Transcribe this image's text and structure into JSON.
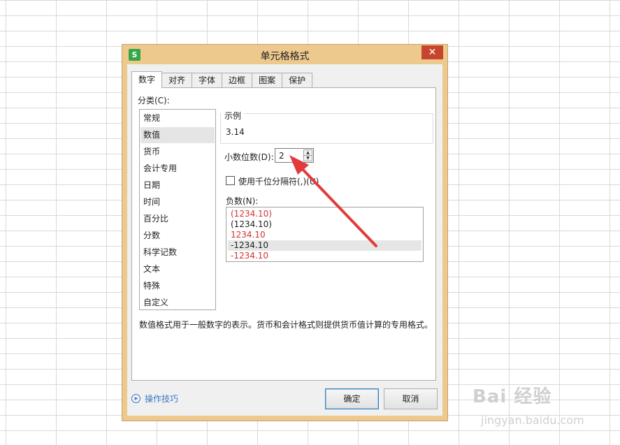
{
  "window": {
    "title": "单元格格式",
    "app_icon_letter": "S",
    "close_glyph": "✕"
  },
  "tabs": [
    {
      "label": "数字",
      "active": true
    },
    {
      "label": "对齐"
    },
    {
      "label": "字体"
    },
    {
      "label": "边框"
    },
    {
      "label": "图案"
    },
    {
      "label": "保护"
    }
  ],
  "category": {
    "label": "分类(C):",
    "items": [
      "常规",
      "数值",
      "货币",
      "会计专用",
      "日期",
      "时间",
      "百分比",
      "分数",
      "科学记数",
      "文本",
      "特殊",
      "自定义"
    ],
    "selected": "数值"
  },
  "sample": {
    "legend": "示例",
    "value": "3.14"
  },
  "decimals": {
    "label": "小数位数(D):",
    "value": "2"
  },
  "thousands": {
    "label": "使用千位分隔符(,)(U)",
    "checked": false
  },
  "negative": {
    "label": "负数(N):",
    "items": [
      "(1234.10)",
      "(1234.10)",
      "1234.10",
      "-1234.10",
      "-1234.10"
    ],
    "red_flags": [
      true,
      false,
      true,
      false,
      true
    ],
    "selected_index": 3
  },
  "description": "数值格式用于一般数字的表示。货币和会计格式则提供货币值计算的专用格式。",
  "footer": {
    "tips_label": "操作技巧",
    "ok_label": "确定",
    "cancel_label": "取消"
  },
  "watermark": {
    "main": "Bai 经验",
    "sub": "jingyan.baidu.com"
  },
  "colors": {
    "dialog_frame": "#eec98d",
    "close_button": "#c7452e",
    "negative_red": "#d33333",
    "annotation_arrow": "#e23b3b",
    "link_blue": "#3a78c8"
  },
  "icons": {
    "app": "wps-spreadsheet-icon",
    "close": "close-icon",
    "spin_up": "up-arrow-icon",
    "spin_down": "down-arrow-icon",
    "tips": "play-circle-icon"
  }
}
